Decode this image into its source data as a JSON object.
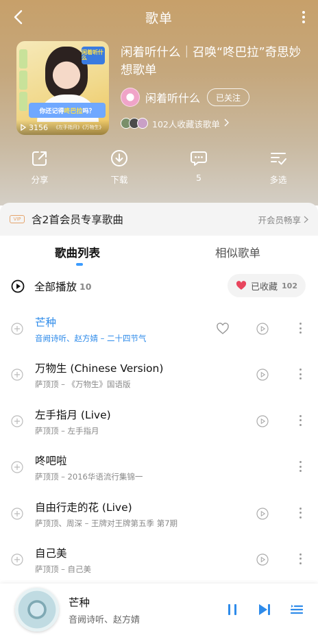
{
  "header": {
    "title": "歌单"
  },
  "playlist": {
    "title": "闲着听什么｜召唤“咚巴拉”奇思妙想歌单",
    "play_count": "3156",
    "cover_tag": "闲着听什么",
    "cover_banner_prefix": "你还记得",
    "cover_banner_highlight": "咚巴拉",
    "cover_banner_suffix": "吗？",
    "cover_subtitle": "《左手指月》《万物生》",
    "creator": "闲着听什么",
    "follow_label": "已关注",
    "collectors_text": "102人收藏该歌单"
  },
  "actions": {
    "share": "分享",
    "download": "下载",
    "comments": "5",
    "multi_select": "多选"
  },
  "vip_bar": {
    "badge": "VIP",
    "text": "含2首会员专享歌曲",
    "open_label": "开会员畅享"
  },
  "tabs": [
    "歌曲列表",
    "相似歌单"
  ],
  "play_all": {
    "label": "全部播放",
    "count": "10",
    "collected_label": "已收藏",
    "collected_count": "102"
  },
  "songs": [
    {
      "title": "芒种",
      "subtitle": "音阙诗听、赵方婧 – 二十四节气"
    },
    {
      "title": "万物生 (Chinese Version)",
      "subtitle": "萨顶顶 – 《万物生》国语版"
    },
    {
      "title": "左手指月 (Live)",
      "subtitle": "萨顶顶 – 左手指月"
    },
    {
      "title": "咚吧啦",
      "subtitle": "萨顶顶 – 2016华语流行集锦一"
    },
    {
      "title": "自由行走的花 (Live)",
      "subtitle": "萨顶顶、周深 – 王牌对王牌第五季 第7期"
    },
    {
      "title": "自己美",
      "subtitle": "萨顶顶 – 自己美"
    }
  ],
  "player": {
    "title": "芒种",
    "artist": "音阙诗听、赵方婧"
  },
  "colors": {
    "accent": "#2e8bea",
    "header_gradient_top": "#c7a06a",
    "heart": "#e8455d"
  }
}
